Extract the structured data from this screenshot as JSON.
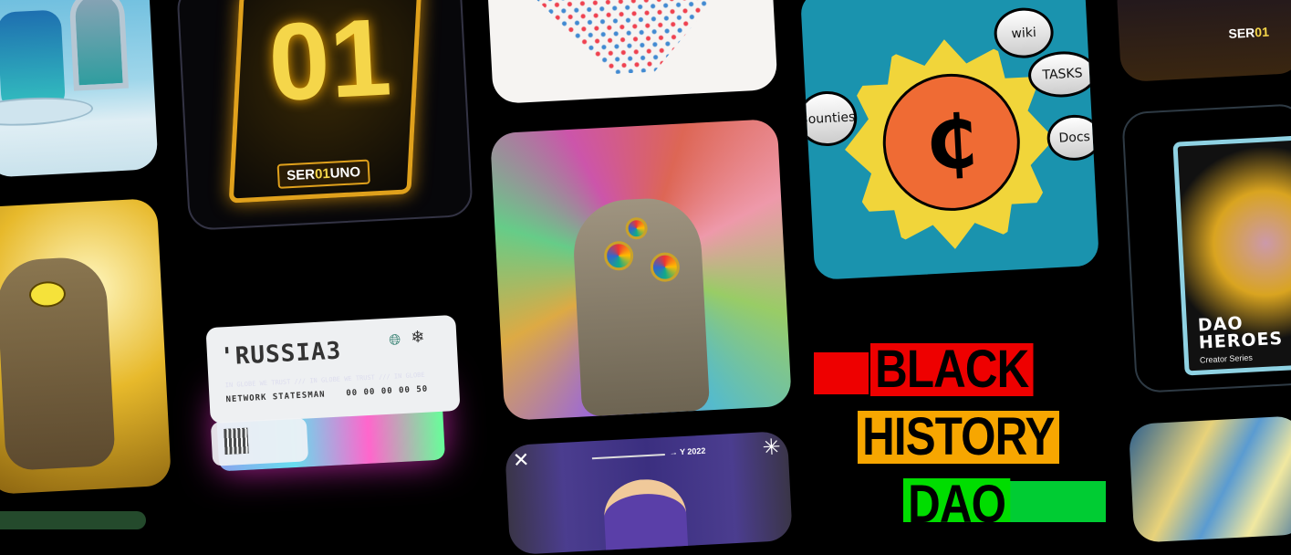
{
  "cards": {
    "robot": {
      "alt": "Blue armored robot figure"
    },
    "gold_01": {
      "number": "01",
      "label_prefix": "SER",
      "label_highlight": "01",
      "label_suffix": "UNO"
    },
    "mandala": {
      "alt": "Colorful geometric mandala"
    },
    "psychedelic_goat": {
      "alt": "Goat with hypnotic eyes on psychedelic background"
    },
    "coin": {
      "symbol": "₵",
      "planets": [
        "wiki",
        "TASKS",
        "Bounties",
        "Docs"
      ]
    },
    "top_right": {
      "label_prefix": "SER",
      "label_highlight": "01"
    },
    "dao_heroes": {
      "title_line1": "DAO",
      "title_line2": "HEROES",
      "subtitle": "Creator Series"
    },
    "golden_goat": {
      "alt": "Golden one-eyed goat"
    },
    "russia3": {
      "logo": "'RUSSIA3",
      "motto": "IN GLOBE WE TRUST /// IN GLOBE WE TRUST /// IN GLOBE",
      "title": "NETWORK STATESMAN",
      "number": "00 00 00 00 50"
    },
    "purple": {
      "year": "→ Y 2022",
      "close_glyph": "✕",
      "star_glyph": "✳"
    },
    "black_history": {
      "line1": "BLACK",
      "line2": "HISTORY",
      "line3": "DAO",
      "colors": {
        "red": "#e00000",
        "orange": "#f7a600",
        "green": "#00dd00"
      }
    },
    "painting": {
      "alt": "Blue and yellow abstract painting"
    }
  },
  "colors": {
    "background": "#000000",
    "gold": "#f5d64a",
    "teal": "#1a93ae"
  }
}
